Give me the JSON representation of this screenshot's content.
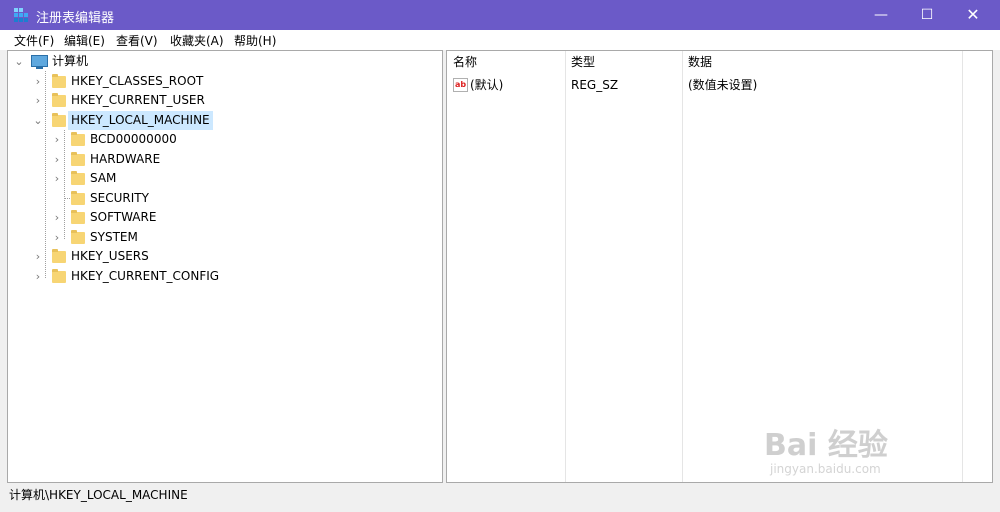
{
  "window": {
    "title": "注册表编辑器",
    "minimize_glyph": "—",
    "maximize_glyph": "☐",
    "close_glyph": "✕"
  },
  "menu": [
    "文件(F)",
    "编辑(E)",
    "查看(V)",
    "收藏夹(A)",
    "帮助(H)"
  ],
  "tree": {
    "root": "计算机",
    "hkcr": "HKEY_CLASSES_ROOT",
    "hkcu": "HKEY_CURRENT_USER",
    "hklm": "HKEY_LOCAL_MACHINE",
    "hklm_children": [
      "BCD00000000",
      "HARDWARE",
      "SAM",
      "SECURITY",
      "SOFTWARE",
      "SYSTEM"
    ],
    "hku": "HKEY_USERS",
    "hkcc": "HKEY_CURRENT_CONFIG"
  },
  "values": {
    "columns": [
      "名称",
      "类型",
      "数据"
    ],
    "rows": [
      {
        "icon": "ab",
        "name": "(默认)",
        "type": "REG_SZ",
        "data": "(数值未设置)"
      }
    ]
  },
  "status": "计算机\\HKEY_LOCAL_MACHINE",
  "watermark": {
    "main": "Bai 经验",
    "sub": "jingyan.baidu.com"
  }
}
